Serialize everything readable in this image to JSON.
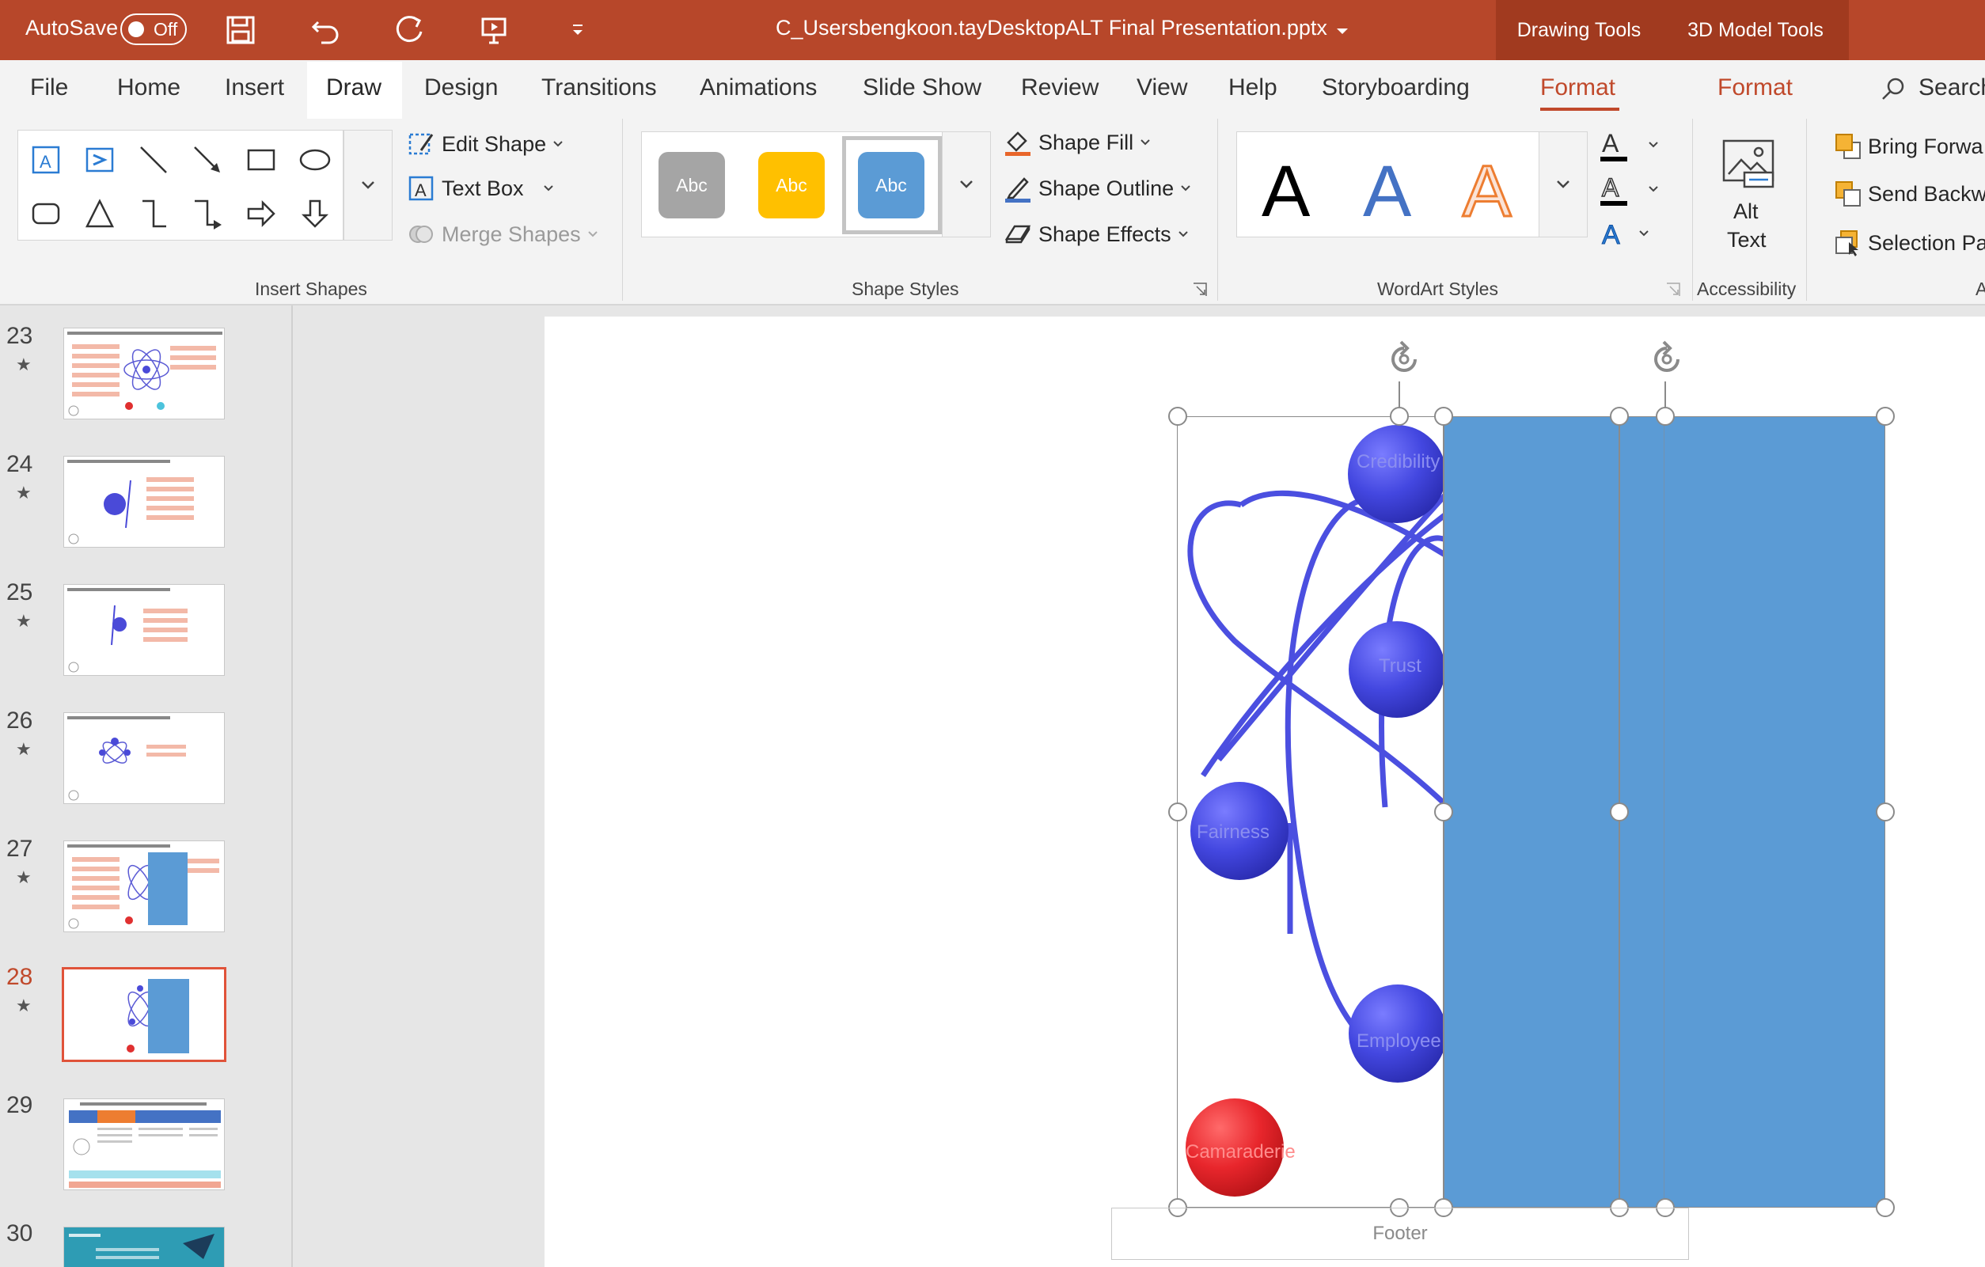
{
  "titlebar": {
    "autosave_label": "AutoSave",
    "autosave_state": "Off",
    "document_title": "C_Usersbengkoon.tayDesktopALT Final  Presentation.pptx",
    "context_tools": [
      "Drawing Tools",
      "3D Model Tools"
    ],
    "accent_color": "#b7472a"
  },
  "menu": {
    "tabs": [
      "File",
      "Home",
      "Insert",
      "Draw",
      "Design",
      "Transitions",
      "Animations",
      "Slide Show",
      "Review",
      "View",
      "Help",
      "Storyboarding",
      "Format",
      "Format"
    ],
    "active_tab": "Draw",
    "search_label": "Search"
  },
  "ribbon": {
    "insert_shapes": {
      "label": "Insert Shapes",
      "shapes": [
        "text-box-icon",
        "vertical-text-box-icon",
        "line-icon",
        "arrow-line-icon",
        "rectangle-icon",
        "oval-icon",
        "rounded-rectangle-icon",
        "triangle-icon",
        "elbow-connector-icon",
        "elbow-arrow-connector-icon",
        "right-arrow-icon",
        "down-arrow-icon"
      ],
      "edit_shape": "Edit Shape",
      "text_box": "Text Box",
      "merge_shapes": "Merge Shapes"
    },
    "shape_styles": {
      "label": "Shape Styles",
      "presets": [
        {
          "text": "Abc",
          "color": "#a5a5a5"
        },
        {
          "text": "Abc",
          "color": "#ffc000"
        },
        {
          "text": "Abc",
          "color": "#5b9bd5"
        }
      ],
      "shape_fill": "Shape Fill",
      "shape_outline": "Shape Outline",
      "shape_effects": "Shape Effects"
    },
    "wordart_styles": {
      "label": "WordArt Styles",
      "letters": [
        "A",
        "A",
        "A"
      ]
    },
    "accessibility": {
      "label": "Accessibility",
      "alt_text_line1": "Alt",
      "alt_text_line2": "Text"
    },
    "arrange": {
      "bring_forward": "Bring Forwa",
      "send_backward": "Send Backwa",
      "selection_pane": "Selection Pa",
      "label": "A"
    }
  },
  "slides": [
    {
      "number": "23",
      "star": "★"
    },
    {
      "number": "24",
      "star": "★"
    },
    {
      "number": "25",
      "star": "★"
    },
    {
      "number": "26",
      "star": "★"
    },
    {
      "number": "27",
      "star": "★"
    },
    {
      "number": "28",
      "star": "★"
    },
    {
      "number": "29",
      "star": ""
    },
    {
      "number": "30",
      "star": ""
    }
  ],
  "current_slide": "28",
  "slide_content": {
    "spheres": [
      "Credibility",
      "Trust",
      "Fairness",
      "Employee",
      "Camaraderie"
    ],
    "footer_placeholder": "Footer",
    "rectangle_color": "#5b9bd5"
  }
}
